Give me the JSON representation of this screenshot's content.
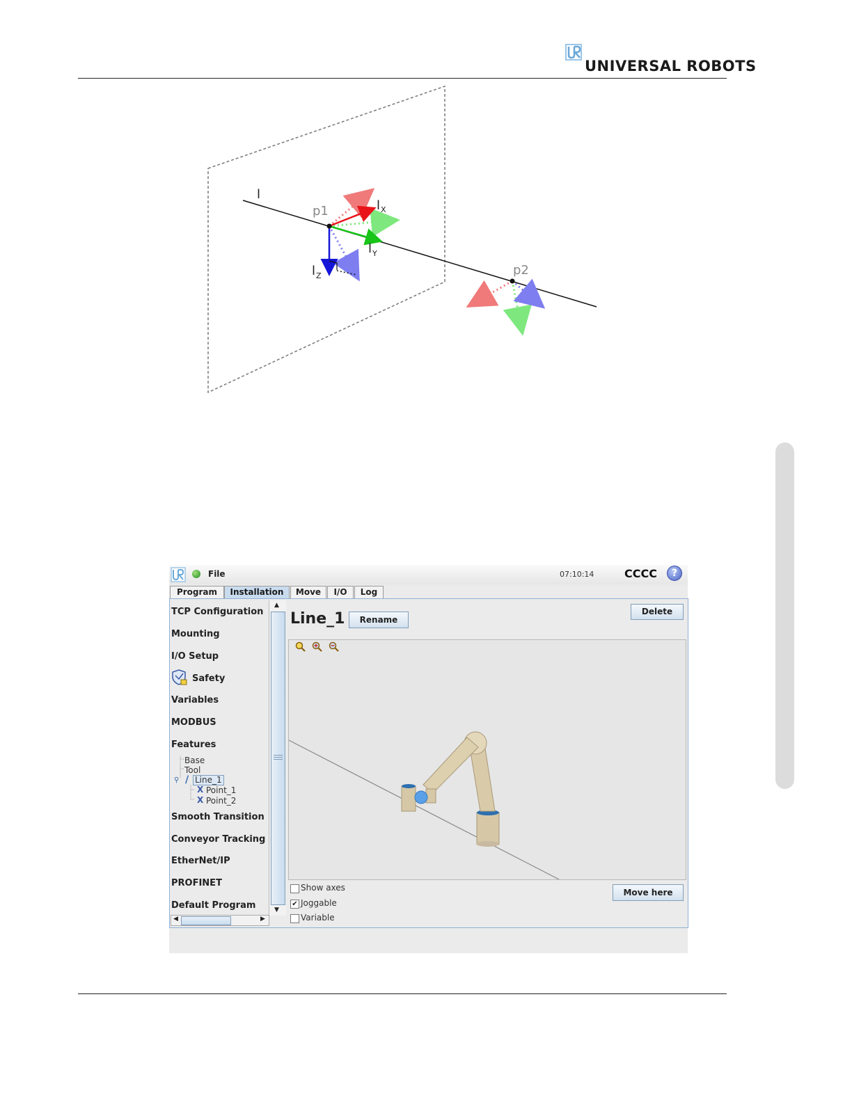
{
  "header": {
    "brand": "UNIVERSAL ROBOTS",
    "logo_icon": "ur-logo-icon"
  },
  "diagram": {
    "labels": {
      "line": "l",
      "p1": "p1",
      "p2": "p2",
      "lx": "l",
      "lx_sub": "X",
      "ly": "l",
      "ly_sub": "Y",
      "lz": "l",
      "lz_sub": "Z"
    },
    "colors": {
      "x_axis": "#e8141a",
      "y_axis": "#17c417",
      "z_axis": "#1515d8",
      "x_dotted": "#f07a7a",
      "y_dotted": "#7ee87e",
      "z_dotted": "#7e7ef0"
    }
  },
  "ui": {
    "topbar": {
      "file_label": "File",
      "time": "07:10:14",
      "robot_name": "CCCC",
      "help_icon": "help-icon",
      "status_icon": "status-green-icon"
    },
    "tabs": [
      "Program",
      "Installation",
      "Move",
      "I/O",
      "Log"
    ],
    "active_tab": "Installation",
    "nav": {
      "items": [
        "TCP Configuration",
        "Mounting",
        "I/O Setup",
        "Safety",
        "Variables",
        "MODBUS",
        "Features",
        "Smooth Transition",
        "Conveyor Tracking",
        "EtherNet/IP",
        "PROFINET",
        "Default Program"
      ],
      "features_tree": {
        "base": "Base",
        "tool": "Tool",
        "line": "Line_1",
        "point1": "Point_1",
        "point2": "Point_2"
      }
    },
    "main": {
      "title": "Line_1",
      "rename_button": "Rename",
      "delete_button": "Delete",
      "move_here_button": "Move here",
      "checkboxes": [
        {
          "label": "Show axes",
          "checked": false
        },
        {
          "label": "Joggable",
          "checked": true
        },
        {
          "label": "Variable",
          "checked": false
        }
      ],
      "check_mark": "✔",
      "zoom_icons": [
        "zoom-fit-icon",
        "zoom-in-icon",
        "zoom-out-icon"
      ]
    },
    "colors": {
      "tab_active": "#c9dcef",
      "frame_border": "#8fb1d6",
      "robot_body": "#d6c8a6",
      "joint_blue": "#2e6fb0"
    }
  }
}
